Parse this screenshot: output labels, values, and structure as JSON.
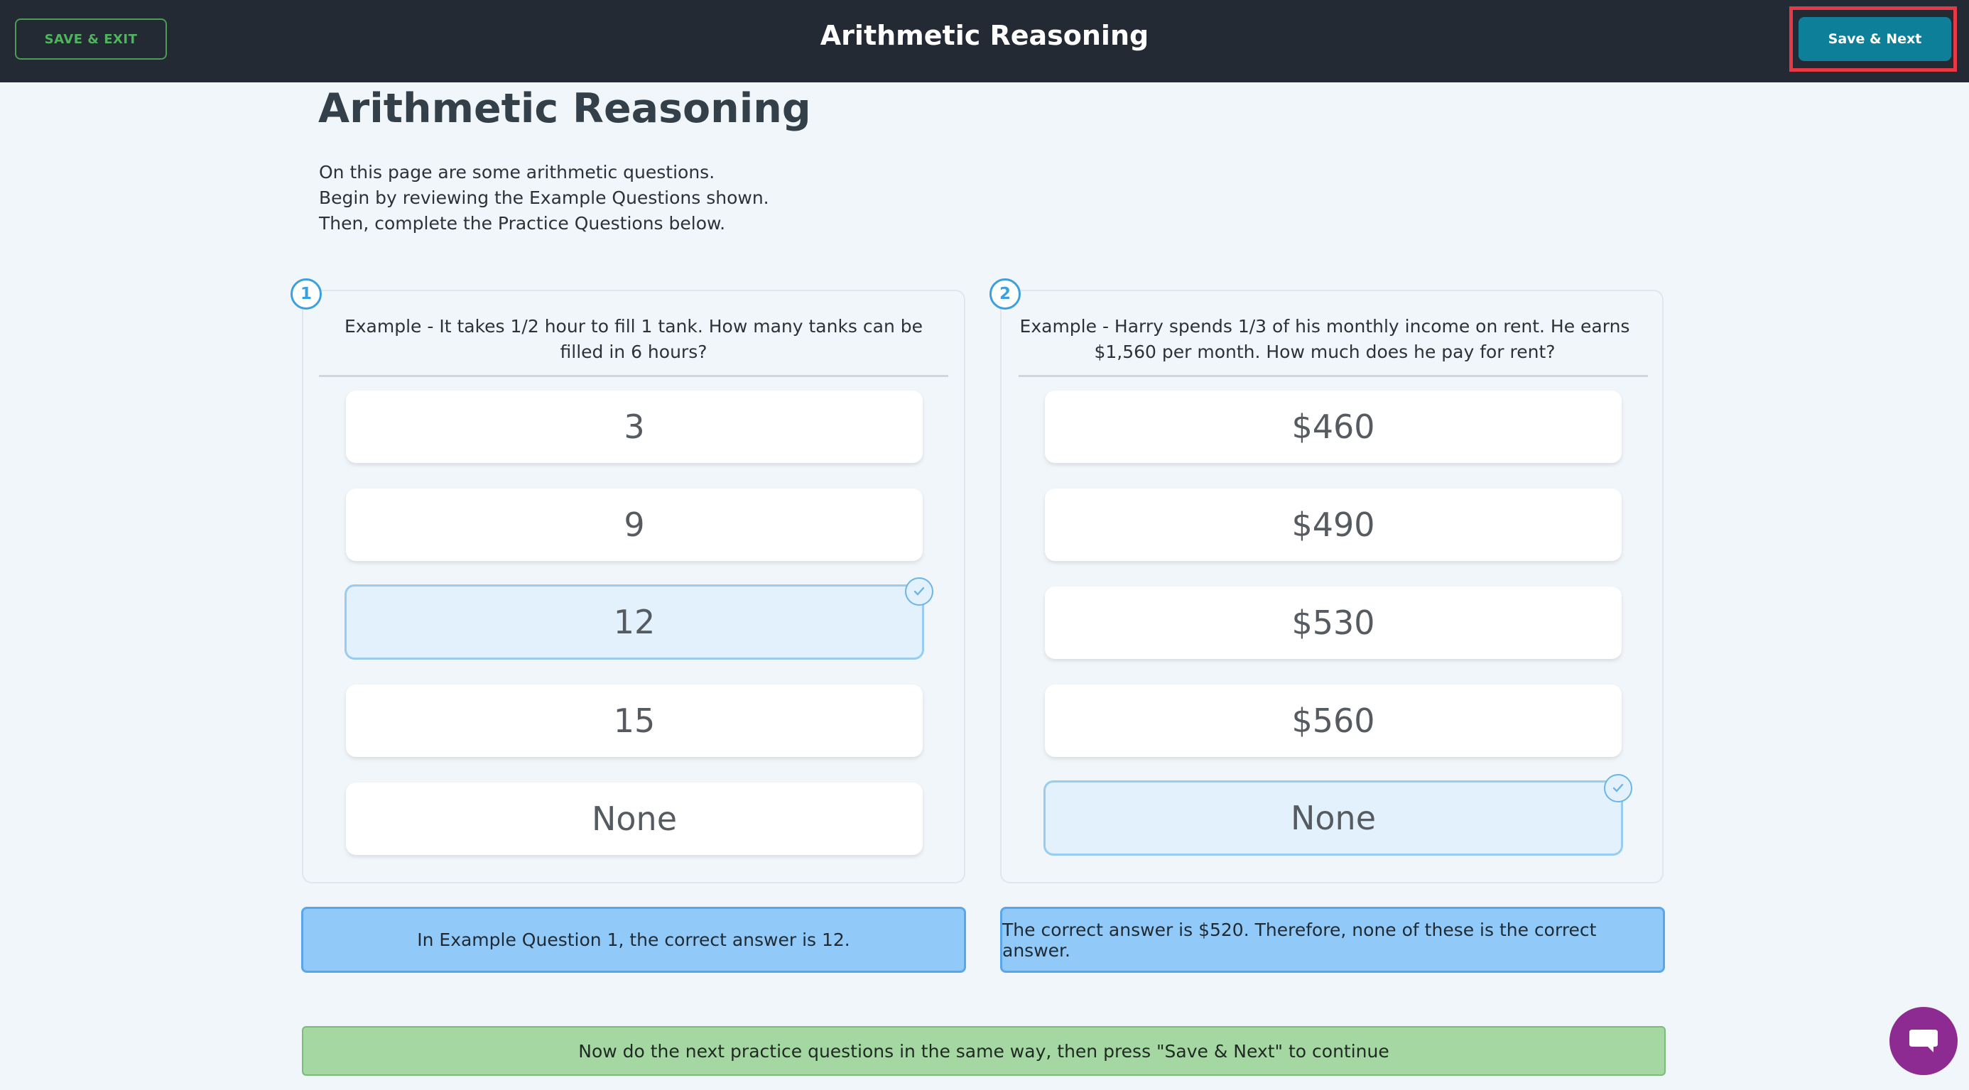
{
  "header": {
    "save_exit_label": "SAVE & EXIT",
    "title": "Arithmetic Reasoning",
    "save_next_label": "Save & Next"
  },
  "page": {
    "title": "Arithmetic Reasoning",
    "intro": [
      "On this page are some arithmetic questions.",
      "Begin by reviewing the Example Questions shown.",
      "Then, complete the Practice Questions below."
    ]
  },
  "questions": [
    {
      "number": "1",
      "text": "Example - It takes 1/2 hour to fill 1 tank. How many tanks can be filled in 6 hours?",
      "options": [
        "3",
        "9",
        "12",
        "15",
        "None"
      ],
      "selected_index": 2,
      "explanation": "In Example Question 1, the correct answer is 12."
    },
    {
      "number": "2",
      "text": "Example - Harry spends 1/3 of his monthly income on rent. He earns $1,560 per month. How much does he pay for rent?",
      "options": [
        "$460",
        "$490",
        "$530",
        "$560",
        "None"
      ],
      "selected_index": 4,
      "explanation": "The correct answer is $520. Therefore, none of these is the correct answer."
    }
  ],
  "footer": {
    "instruction": "Now do the next practice questions in the same way, then press \"Save & Next\" to continue"
  },
  "icons": {
    "check": "check-circle-icon",
    "chat": "chat-bubble-icon"
  },
  "colors": {
    "topbar": "#232a33",
    "accent_teal": "#0e7f98",
    "exit_green": "#4eb55c",
    "highlight_red": "#e53945",
    "selected_bg": "#e3f1fc",
    "explain_bg": "#91c9f8",
    "banner_bg": "#a5d7a3",
    "chat_purple": "#8d2b93"
  }
}
